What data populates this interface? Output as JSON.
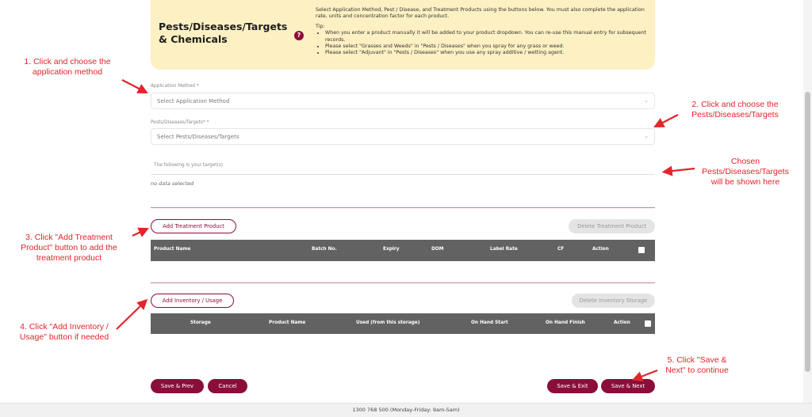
{
  "header": {
    "title_line1": "Pests/Diseases/Targets",
    "title_line2": "& Chemicals",
    "help_glyph": "?",
    "intro": "Select Application Method, Pest / Disease, and Treatment Products using the buttons below. You must also complete the application rate, units and concentration factor for each product.",
    "tip_label": "Tip:",
    "tips": [
      "When you enter a product manually it will be added to your product dropdown. You can re-use this manual entry for subsequent records.",
      "Please select \"Grasses and Weeds\" in \"Pests / Diseases\" when you spray for any grass or weed.",
      "Please select \"Adjuvant\" in \"Pests / Diseases\" when you use any spray additive / wetting agent."
    ]
  },
  "form": {
    "application_method": {
      "label": "Application Method *",
      "placeholder": "Select Application Method"
    },
    "pests": {
      "label": "Pests/Diseases/Targets* *",
      "placeholder": "Select Pests/Diseases/Targets"
    },
    "targets_label": "The following is your target(s)",
    "no_data": "no data selected"
  },
  "treatment": {
    "add_label": "Add Treatment Product",
    "delete_label": "Delete Treatment Product",
    "columns": [
      "Product Name",
      "Batch No.",
      "Expiry",
      "DOM",
      "Label Rate",
      "CF",
      "Action"
    ]
  },
  "inventory": {
    "add_label": "Add Inventory / Usage",
    "delete_label": "Delete Inventory Storage",
    "columns": [
      "Storage",
      "Product Name",
      "Used (from this storage)",
      "On Hand Start",
      "On Hand Finish",
      "Action"
    ]
  },
  "actions": {
    "save_prev": "Save & Prev",
    "cancel": "Cancel",
    "save_exit": "Save & Exit",
    "save_next": "Save & Next"
  },
  "footer": {
    "phone": "1300 768 500 (Monday-Friday: 9am-5am)"
  },
  "annotations": {
    "a1": [
      "1. Click and choose the",
      "application method"
    ],
    "a2": [
      "2. Click and choose the",
      "Pests/Diseases/Targets"
    ],
    "a_chosen": [
      "Chosen",
      "Pests/Diseases/Targets",
      "will be shown here"
    ],
    "a3": [
      "3. Click \"Add Treatment",
      "Product\" button to add the",
      "treatment product"
    ],
    "a4": [
      "4. Click \"Add Inventory /",
      "Usage\" button if needed"
    ],
    "a5": [
      "5. Click \"Save &",
      "Next\" to continue"
    ]
  },
  "colors": {
    "brand": "#8b0e3a",
    "header_bg": "#fdf0c2",
    "table_header": "#626262",
    "annotation": "#e3242b"
  }
}
